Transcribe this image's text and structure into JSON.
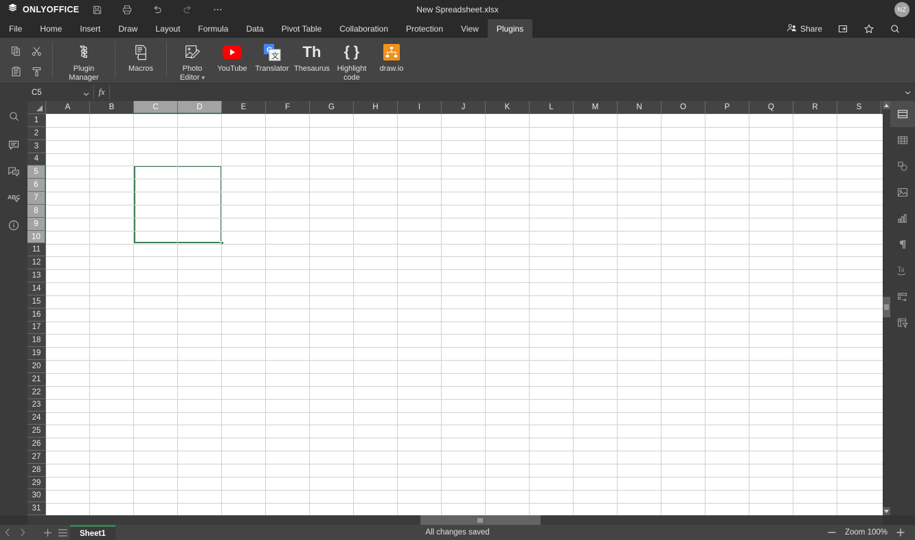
{
  "titlebar": {
    "brand": "ONLYOFFICE",
    "brand_icon": "layers-icon",
    "doc_title": "New Spreadsheet.xlsx",
    "quick_access": [
      {
        "name": "save-icon",
        "label": "Save"
      },
      {
        "name": "print-icon",
        "label": "Print"
      },
      {
        "name": "undo-icon",
        "label": "Undo"
      },
      {
        "name": "redo-icon",
        "label": "Redo"
      },
      {
        "name": "more-icon",
        "label": "Customize Quick Access Toolbar"
      }
    ],
    "avatar_initials": "NZ"
  },
  "menubar": {
    "items": [
      {
        "label": "File"
      },
      {
        "label": "Home"
      },
      {
        "label": "Insert"
      },
      {
        "label": "Draw"
      },
      {
        "label": "Layout"
      },
      {
        "label": "Formula"
      },
      {
        "label": "Data"
      },
      {
        "label": "Pivot Table"
      },
      {
        "label": "Collaboration"
      },
      {
        "label": "Protection"
      },
      {
        "label": "View"
      },
      {
        "label": "Plugins"
      }
    ],
    "active_index": 11,
    "share_label": "Share",
    "right_icons": [
      {
        "name": "open-file-location-icon"
      },
      {
        "name": "favorite-star-icon"
      },
      {
        "name": "search-icon"
      }
    ]
  },
  "toolbar": {
    "clipboard": [
      {
        "name": "copy-icon"
      },
      {
        "name": "cut-icon"
      },
      {
        "name": "paste-icon"
      },
      {
        "name": "format-painter-icon"
      }
    ],
    "plugins": [
      {
        "label": "Plugin Manager",
        "icon": "puzzle-icon"
      },
      {
        "label": "Macros",
        "icon": "macros-icon"
      },
      {
        "label": "Photo Editor",
        "icon": "photo-editor-icon",
        "dropdown": true
      },
      {
        "label": "YouTube",
        "icon": "youtube-icon"
      },
      {
        "label": "Translator",
        "icon": "translator-icon"
      },
      {
        "label": "Thesaurus",
        "icon": "thesaurus-icon",
        "glyph": "Th"
      },
      {
        "label": "Highlight code",
        "icon": "braces-icon",
        "glyph": "{ }"
      },
      {
        "label": "draw.io",
        "icon": "drawio-icon"
      }
    ]
  },
  "formulabar": {
    "name_box_value": "C5",
    "fx_label": "fx",
    "formula_value": "",
    "expand_icon": "chevron-down-icon"
  },
  "left_rail": [
    {
      "name": "search-icon"
    },
    {
      "name": "comments-icon"
    },
    {
      "name": "chat-icon"
    },
    {
      "name": "spellcheck-icon"
    },
    {
      "name": "about-icon"
    }
  ],
  "right_rail": [
    {
      "name": "cell-settings-icon",
      "selected": true
    },
    {
      "name": "table-settings-icon",
      "selected": false
    },
    {
      "name": "shape-settings-icon",
      "selected": false
    },
    {
      "name": "image-settings-icon",
      "selected": false
    },
    {
      "name": "chart-settings-icon",
      "selected": false
    },
    {
      "name": "paragraph-settings-icon",
      "selected": false
    },
    {
      "name": "text-art-settings-icon",
      "selected": false
    },
    {
      "name": "slicer-settings-icon",
      "selected": false
    },
    {
      "name": "pivot-table-settings-icon",
      "selected": false
    }
  ],
  "grid": {
    "columns": [
      "A",
      "B",
      "C",
      "D",
      "E",
      "F",
      "G",
      "H",
      "I",
      "J",
      "K",
      "L",
      "M",
      "N",
      "O",
      "P",
      "Q",
      "R",
      "S"
    ],
    "rows": [
      1,
      2,
      3,
      4,
      5,
      6,
      7,
      8,
      9,
      10,
      11,
      12,
      13,
      14,
      15,
      16,
      17,
      18,
      19,
      20,
      21,
      22,
      23,
      24,
      25,
      26,
      27,
      28,
      29,
      30,
      31
    ],
    "selected_columns": [
      "C",
      "D"
    ],
    "selected_rows": [
      5,
      6,
      7,
      8,
      9,
      10
    ],
    "selection_range": "C5:D10",
    "selection_color": "#3d7d56",
    "cell_values": []
  },
  "statusbar": {
    "prev_sheet_icon": "chevron-left-icon",
    "next_sheet_icon": "chevron-right-icon",
    "add_sheet_icon": "plus-icon",
    "sheet_list_icon": "list-icon",
    "sheets": [
      {
        "label": "Sheet1",
        "active": true
      }
    ],
    "status_text": "All changes saved",
    "zoom_out_icon": "minus-icon",
    "zoom_label": "Zoom 100%",
    "zoom_in_icon": "plus-icon"
  }
}
